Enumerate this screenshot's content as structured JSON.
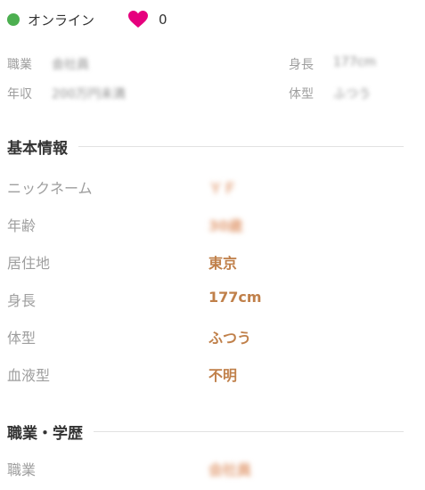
{
  "status": {
    "online_label": "オンライン",
    "like_count": "0",
    "online_color": "#4caf50",
    "heart_color": "#e6007e"
  },
  "summary": {
    "rows": [
      {
        "label1": "職業",
        "value1": "会社員",
        "label2": "身長",
        "value2": "177cm"
      },
      {
        "label1": "年収",
        "value1": "200万円未満",
        "label2": "体型",
        "value2": "ふつう"
      }
    ]
  },
  "sections": {
    "basic": {
      "title": "基本情報",
      "items": [
        {
          "label": "ニックネーム",
          "value": "ＹＦ"
        },
        {
          "label": "年齢",
          "value": "30歳"
        },
        {
          "label": "居住地",
          "value": "東京"
        },
        {
          "label": "身長",
          "value": "177cm"
        },
        {
          "label": "体型",
          "value": "ふつう"
        },
        {
          "label": "血液型",
          "value": "不明"
        }
      ]
    },
    "career": {
      "title": "職業・学歴",
      "items": [
        {
          "label": "職業",
          "value": "会社員"
        }
      ]
    }
  },
  "colors": {
    "accent_value": "#c0804a",
    "label_gray": "#9e9e9e"
  }
}
